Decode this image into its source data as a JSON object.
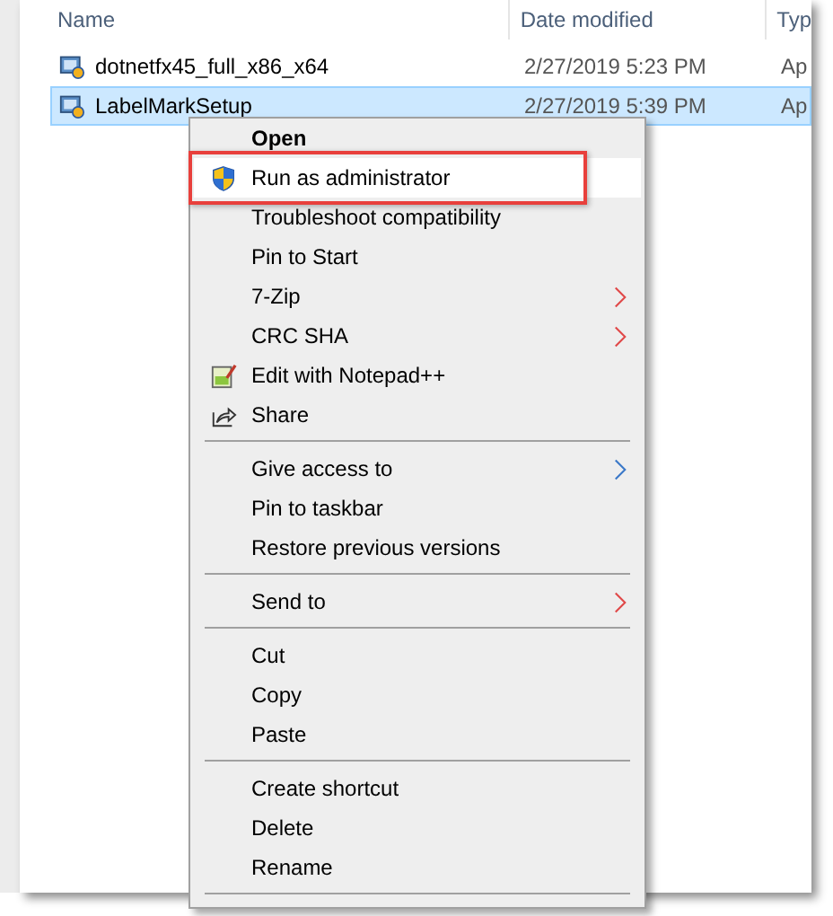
{
  "columns": [
    {
      "label": "Name"
    },
    {
      "label": "Date modified"
    },
    {
      "label": "Typ"
    }
  ],
  "files": [
    {
      "name": "dotnetfx45_full_x86_x64",
      "date": "2/27/2019 5:23 PM",
      "type": "Ap",
      "selected": false
    },
    {
      "name": "LabelMarkSetup",
      "date": "2/27/2019 5:39 PM",
      "type": "Ap",
      "selected": true
    }
  ],
  "context_menu": [
    {
      "kind": "plain",
      "label": "Open",
      "bold": true,
      "highlighted": false,
      "annotated": false
    },
    {
      "kind": "shield",
      "label": "Run as administrator",
      "bold": false,
      "highlighted": true,
      "annotated": true
    },
    {
      "kind": "plain",
      "label": "Troubleshoot compatibility",
      "bold": false,
      "highlighted": false,
      "annotated": false
    },
    {
      "kind": "plain",
      "label": "Pin to Start",
      "bold": false,
      "highlighted": false,
      "annotated": false
    },
    {
      "kind": "submenu",
      "label": "7-Zip",
      "color": "#e04848",
      "bold": false,
      "highlighted": false,
      "annotated": false
    },
    {
      "kind": "submenu",
      "label": "CRC SHA",
      "color": "#e04848",
      "bold": false,
      "highlighted": false,
      "annotated": false
    },
    {
      "kind": "notepad",
      "label": "Edit with Notepad++",
      "bold": false,
      "highlighted": false,
      "annotated": false
    },
    {
      "kind": "share",
      "label": "Share",
      "bold": false,
      "highlighted": false,
      "annotated": false
    },
    {
      "kind": "separator"
    },
    {
      "kind": "submenu",
      "label": "Give access to",
      "color": "#3a78c8",
      "bold": false,
      "highlighted": false,
      "annotated": false
    },
    {
      "kind": "plain",
      "label": "Pin to taskbar",
      "bold": false,
      "highlighted": false,
      "annotated": false
    },
    {
      "kind": "plain",
      "label": "Restore previous versions",
      "bold": false,
      "highlighted": false,
      "annotated": false
    },
    {
      "kind": "separator"
    },
    {
      "kind": "submenu",
      "label": "Send to",
      "color": "#e04848",
      "bold": false,
      "highlighted": false,
      "annotated": false
    },
    {
      "kind": "separator"
    },
    {
      "kind": "plain",
      "label": "Cut",
      "bold": false,
      "highlighted": false,
      "annotated": false
    },
    {
      "kind": "plain",
      "label": "Copy",
      "bold": false,
      "highlighted": false,
      "annotated": false
    },
    {
      "kind": "plain",
      "label": "Paste",
      "bold": false,
      "highlighted": false,
      "annotated": false
    },
    {
      "kind": "separator"
    },
    {
      "kind": "plain",
      "label": "Create shortcut",
      "bold": false,
      "highlighted": false,
      "annotated": false
    },
    {
      "kind": "plain",
      "label": "Delete",
      "bold": false,
      "highlighted": false,
      "annotated": false
    },
    {
      "kind": "plain",
      "label": "Rename",
      "bold": false,
      "highlighted": false,
      "annotated": false
    },
    {
      "kind": "separator"
    }
  ]
}
